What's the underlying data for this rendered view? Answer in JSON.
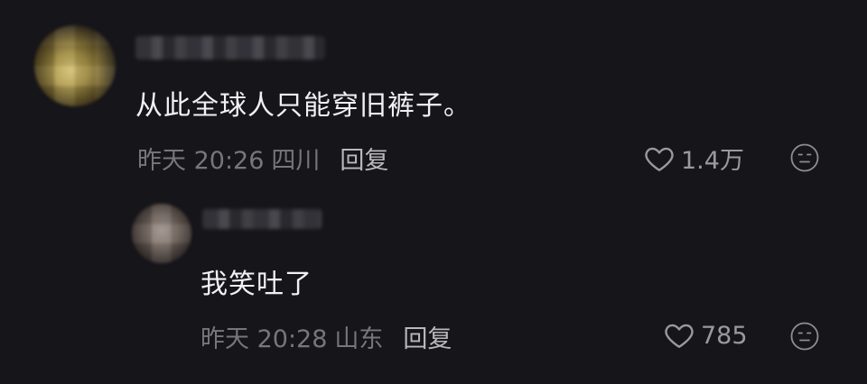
{
  "comments": [
    {
      "text": "从此全球人只能穿旧裤子。",
      "time": "昨天 20:26",
      "location": "四川",
      "reply_label": "回复",
      "likes": "1.4万"
    },
    {
      "text": "我笑吐了",
      "time": "昨天 20:28",
      "location": "山东",
      "reply_label": "回复",
      "likes": "785"
    }
  ],
  "icons": {
    "like": "heart-outline-icon",
    "dislike": "neutral-face-icon"
  },
  "colors": {
    "background": "#161519",
    "text": "#f1f1f3",
    "meta": "#77767d",
    "reply": "#b9b8be"
  }
}
